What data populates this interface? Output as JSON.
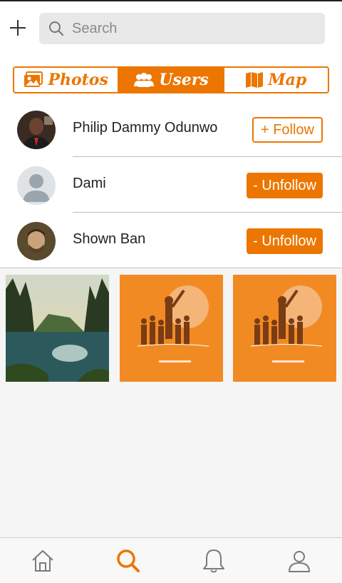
{
  "search": {
    "placeholder": "Search"
  },
  "tabs": [
    {
      "label": "Photos",
      "icon": "photos-icon",
      "active": false
    },
    {
      "label": "Users",
      "icon": "users-icon",
      "active": true
    },
    {
      "label": "Map",
      "icon": "map-icon",
      "active": false
    }
  ],
  "users": [
    {
      "name": "Philip Dammy Odunwo",
      "action": "+ Follow",
      "avatar": "photo-avatar"
    },
    {
      "name": "Dami",
      "action": "- Unfollow",
      "avatar": "default-avatar"
    },
    {
      "name": "Shown Ban",
      "action": "- Unfollow",
      "avatar": "photo-avatar"
    }
  ],
  "photos": [
    {
      "subject": "forest lake"
    },
    {
      "subject": "orange crowd poster"
    },
    {
      "subject": "orange crowd poster"
    }
  ],
  "bottom_nav": [
    {
      "icon": "home-icon",
      "active": false
    },
    {
      "icon": "search-icon",
      "active": true
    },
    {
      "icon": "bell-icon",
      "active": false
    },
    {
      "icon": "profile-icon",
      "active": false
    }
  ],
  "colors": {
    "accent": "#ec7600",
    "inactive_icon": "#7a7a7a",
    "search_bg": "#e8e8e8"
  }
}
